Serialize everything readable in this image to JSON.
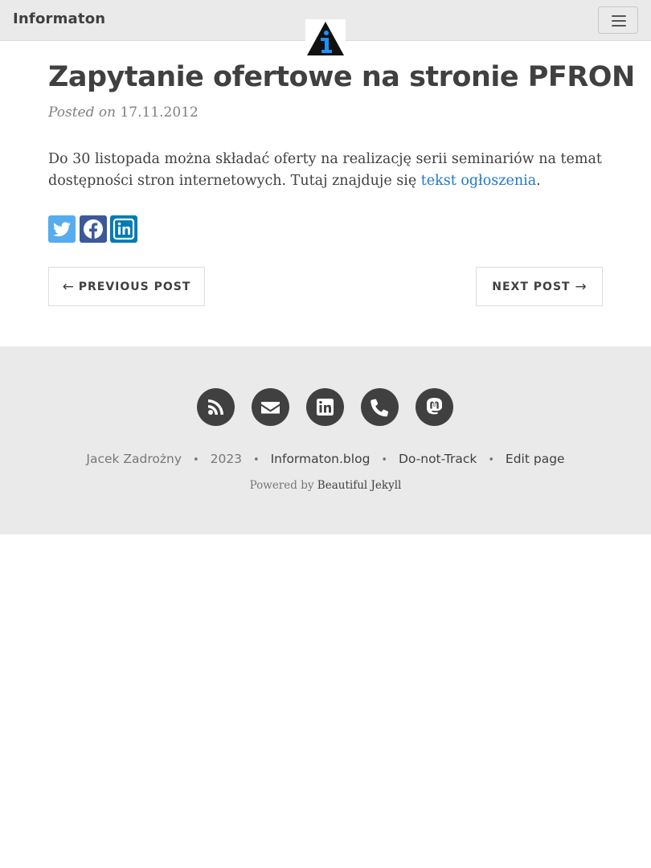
{
  "navbar": {
    "brand": "Informaton",
    "logo_icon": "informaton-logo",
    "menu_icon": "hamburger-menu-icon"
  },
  "post": {
    "title": "Zapytanie ofertowe na stronie PFRON",
    "meta_prefix": "Posted on",
    "date": "17.11.2012",
    "body_text": "Do 30 listopada można składać oferty na realizację serii seminariów na temat dostępności stron internetowych. Tutaj znajduje się ",
    "body_link": "tekst ogłoszenia",
    "body_end": "."
  },
  "share": {
    "items": [
      {
        "name": "twitter",
        "icon": "twitter-icon",
        "color": "#55acee"
      },
      {
        "name": "facebook",
        "icon": "facebook-icon",
        "color": "#3b5998"
      },
      {
        "name": "linkedin",
        "icon": "linkedin-icon",
        "color": "#007bb5"
      }
    ]
  },
  "pager": {
    "prev_arrow": "←",
    "prev_label": "PREVIOUS POST",
    "next_label": "NEXT POST",
    "next_arrow": "→"
  },
  "footer": {
    "social": [
      {
        "name": "rss",
        "icon": "rss-icon"
      },
      {
        "name": "email",
        "icon": "envelope-icon"
      },
      {
        "name": "linkedin",
        "icon": "linkedin-icon"
      },
      {
        "name": "phone",
        "icon": "phone-icon"
      },
      {
        "name": "mastodon",
        "icon": "mastodon-icon"
      }
    ],
    "author": "Jacek Zadrożny",
    "year": "2023",
    "links": [
      "Informaton.blog",
      "Do-not-Track",
      "Edit page"
    ],
    "separator": "•",
    "powered_prefix": "Powered by",
    "powered_link": "Beautiful Jekyll"
  },
  "colors": {
    "navbar_bg": "#eaeaea",
    "footer_bg": "#eaeaea",
    "text": "#404040",
    "link": "#2277cc",
    "muted": "#808080"
  }
}
